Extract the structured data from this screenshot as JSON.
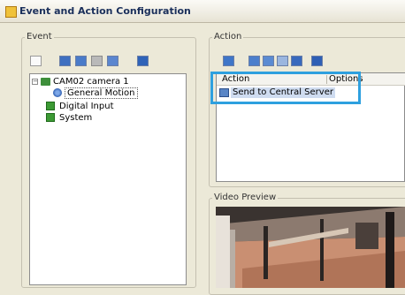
{
  "window": {
    "title": "Event and Action Configuration"
  },
  "event": {
    "group_label": "Event",
    "toolbar_icons": [
      "new-icon",
      "save-icon",
      "copy-icon",
      "delete-icon",
      "properties-icon",
      "export-icon"
    ],
    "tree": [
      {
        "label": "CAM02 camera 1",
        "icon": "camera-icon",
        "expander": "−"
      },
      {
        "label": "General Motion",
        "icon": "motion-icon"
      },
      {
        "label": "Digital Input",
        "icon": "digital-input-icon"
      },
      {
        "label": "System",
        "icon": "system-icon"
      }
    ]
  },
  "action": {
    "group_label": "Action",
    "toolbar_icons": [
      "send-icon",
      "email-icon",
      "record-icon",
      "ptz-icon",
      "output-icon",
      "alarm-icon"
    ],
    "columns": [
      "Action",
      "Options"
    ],
    "rows": [
      {
        "label": "Send to Central Server",
        "icon": "server-icon"
      }
    ]
  },
  "preview": {
    "group_label": "Video Preview"
  },
  "colors": {
    "highlight": "#2ea0df",
    "title": "#1a2f5b",
    "selection": "#cfdcf0"
  }
}
